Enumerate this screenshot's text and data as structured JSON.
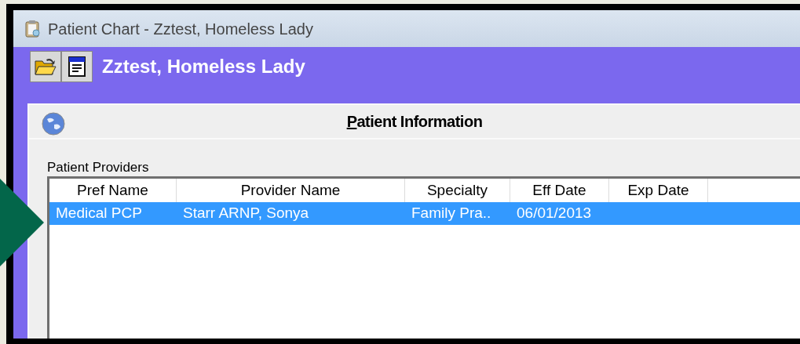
{
  "window": {
    "title": "Patient Chart - Zztest, Homeless Lady"
  },
  "header": {
    "patient_name": "Zztest, Homeless Lady"
  },
  "panel": {
    "title": "Patient Information"
  },
  "providers": {
    "label": "Patient Providers",
    "columns": [
      "Pref Name",
      "Provider Name",
      "Specialty",
      "Eff Date",
      "Exp Date"
    ],
    "rows": [
      {
        "selected": true,
        "cells": [
          "Medical PCP",
          "Starr ARNP, Sonya",
          "Family Pra..",
          "06/01/2013",
          ""
        ]
      }
    ]
  }
}
